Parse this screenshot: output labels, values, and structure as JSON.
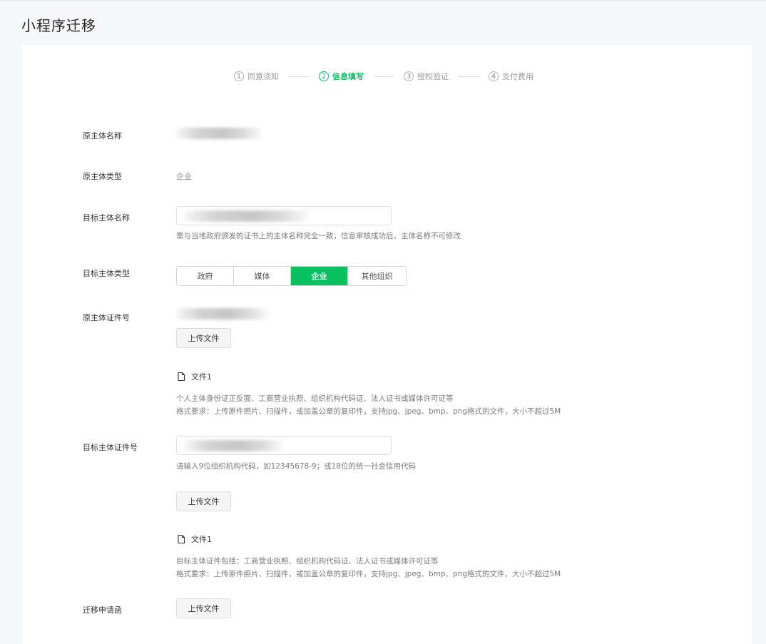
{
  "page": {
    "title": "小程序迁移"
  },
  "steps": [
    {
      "num": "1",
      "label": "同意须知"
    },
    {
      "num": "2",
      "label": "信息填写"
    },
    {
      "num": "3",
      "label": "授权验证"
    },
    {
      "num": "4",
      "label": "支付费用"
    }
  ],
  "form": {
    "orig_name_label": "原主体名称",
    "orig_type_label": "原主体类型",
    "orig_type_value": "企业",
    "target_name_label": "目标主体名称",
    "target_name_hint": "需与当地政府颁发的证书上的主体名称完全一致，信息审核成功后，主体名称不可修改",
    "target_type_label": "目标主体类型",
    "target_type_options": [
      "政府",
      "媒体",
      "企业",
      "其他组织"
    ],
    "orig_cert_label": "原主体证件号",
    "orig_cert_upload": "上传文件",
    "orig_cert_file": "文件1",
    "orig_cert_hint1": "个人主体身份证正反面、工商营业执照、组织机构代码证、法人证书或媒体许可证等",
    "orig_cert_hint2": "格式要求：上传原件照片、扫描件，或加盖公章的复印件，支持jpg、jpeg、bmp、png格式的文件，大小不超过5M",
    "target_cert_label": "目标主体证件号",
    "target_cert_hint": "请输入9位组织机构代码，如12345678-9；或18位的统一社会信用代码",
    "target_cert_upload": "上传文件",
    "target_cert_file": "文件1",
    "target_cert_hint1": "目标主体证件包括：工商营业执照、组织机构代码证、法人证书或媒体许可证等",
    "target_cert_hint2": "格式要求：上传原件照片、扫描件，或加盖公章的复印件，支持jpg、jpeg、bmp、png格式的文件，大小不超过5M",
    "letter_label": "迁移申请函",
    "letter_upload": "上传文件"
  },
  "colors": {
    "accent": "#07c160"
  }
}
